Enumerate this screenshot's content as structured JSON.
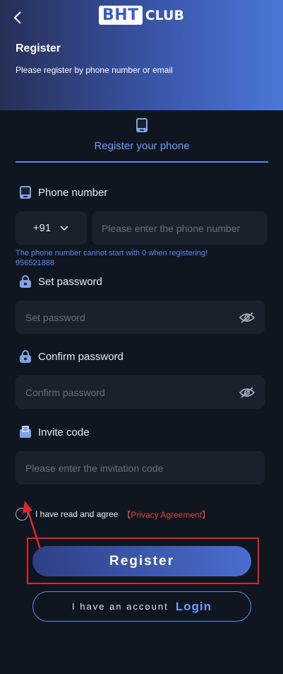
{
  "header": {
    "back_icon": "chevron-left-icon",
    "logo_box": "BHT",
    "logo_text": "CLUB",
    "title": "Register",
    "subtitle": "Please register by phone number or email"
  },
  "tab": {
    "icon": "phone-icon",
    "label": "Register your phone"
  },
  "phone": {
    "label": "Phone number",
    "country_code": "+91",
    "placeholder": "Please enter the phone number",
    "hint_line1": "The phone number cannot start with 0 when registering!",
    "hint_line2": "956521888"
  },
  "password": {
    "label": "Set password",
    "placeholder": "Set password"
  },
  "confirm": {
    "label": "Confirm password",
    "placeholder": "Confirm password"
  },
  "invite": {
    "label": "Invite code",
    "placeholder": "Please enter the invitation code"
  },
  "agreement": {
    "text": "I have read and agree",
    "link": "【Privacy Agreement】"
  },
  "buttons": {
    "register": "Register",
    "login_question": "I have an account",
    "login_action": "Login"
  },
  "colors": {
    "accent": "#5b8bf0",
    "background": "#0f1620",
    "field": "#1a212c",
    "highlight": "#e0262c"
  }
}
